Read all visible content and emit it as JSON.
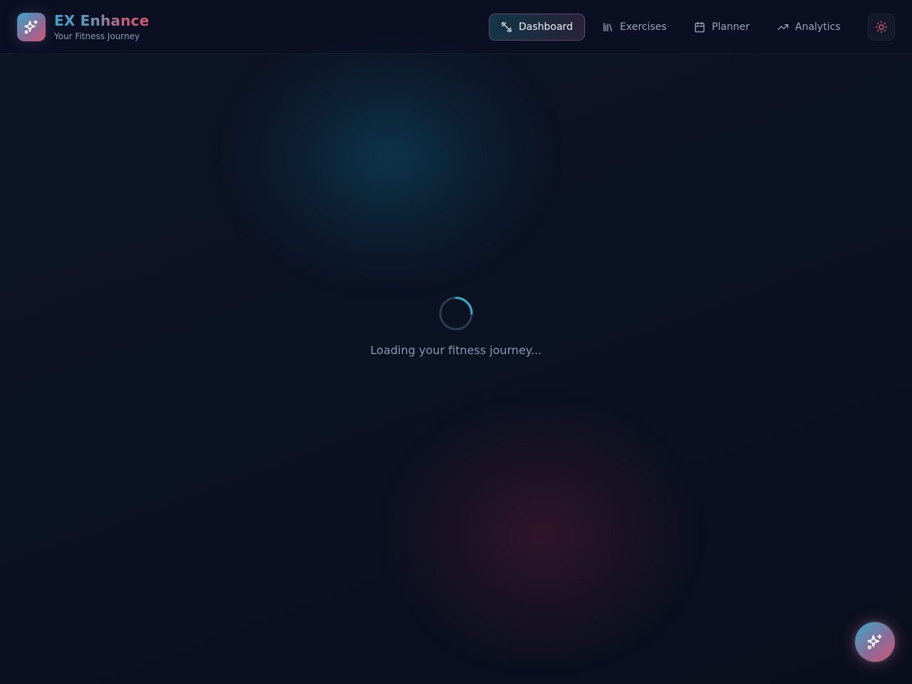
{
  "app": {
    "title": "EX Enhance",
    "subtitle": "Your Fitness Journey",
    "logo_icon": "sparkles-icon"
  },
  "nav": {
    "items": [
      {
        "label": "Dashboard",
        "icon": "dumbbell-icon",
        "active": true
      },
      {
        "label": "Exercises",
        "icon": "library-icon",
        "active": false
      },
      {
        "label": "Planner",
        "icon": "calendar-icon",
        "active": false
      },
      {
        "label": "Analytics",
        "icon": "trending-up-icon",
        "active": false
      }
    ],
    "theme_toggle_icon": "sun-icon"
  },
  "main": {
    "loading_text": "Loading your fitness journey..."
  },
  "fab": {
    "icon": "sparkles-icon"
  },
  "colors": {
    "accent_teal": "#3aa8c9",
    "accent_pink": "#d2566f",
    "background": "#0b1120"
  }
}
